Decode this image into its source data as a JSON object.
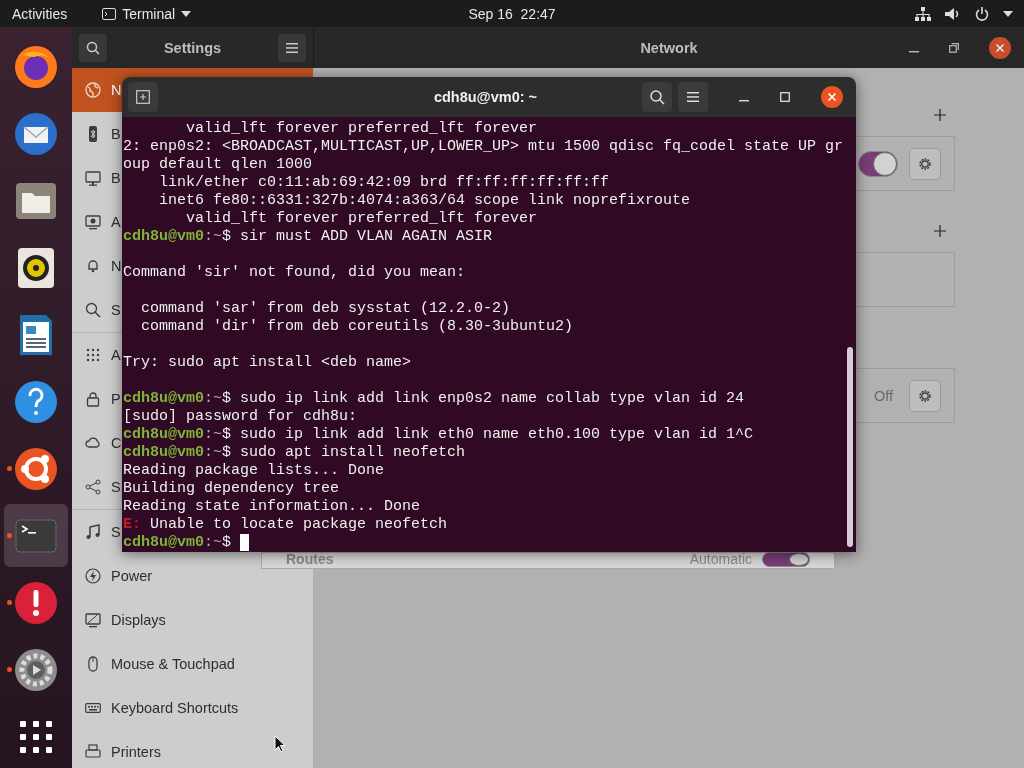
{
  "top_bar": {
    "activities": "Activities",
    "app_menu": "Terminal",
    "clock": "Sep 16  22:47"
  },
  "dock": [
    {
      "kind": "browser",
      "running": false,
      "selected": false
    },
    {
      "kind": "mail",
      "running": false,
      "selected": false
    },
    {
      "kind": "folder",
      "running": false,
      "selected": false
    },
    {
      "kind": "speaker",
      "running": false,
      "selected": false
    },
    {
      "kind": "document",
      "running": false,
      "selected": false
    },
    {
      "kind": "help",
      "running": false,
      "selected": false
    },
    {
      "kind": "software",
      "running": true,
      "selected": false
    },
    {
      "kind": "terminal",
      "running": true,
      "selected": true
    },
    {
      "kind": "alert",
      "running": true,
      "selected": false
    },
    {
      "kind": "settings",
      "running": true,
      "selected": false
    },
    {
      "kind": "grid",
      "running": false,
      "selected": false
    }
  ],
  "settings": {
    "title": "Settings",
    "panel_title": "Network",
    "sidebar": [
      {
        "items": [
          {
            "kind": "network",
            "label": "N",
            "selected": true
          },
          {
            "kind": "bluetooth",
            "label": "B",
            "selected": false
          },
          {
            "kind": "background",
            "label": "B",
            "selected": false
          },
          {
            "kind": "appearance",
            "label": "A",
            "selected": false
          },
          {
            "kind": "notifications",
            "label": "N",
            "selected": false
          },
          {
            "kind": "search",
            "label": "S",
            "selected": false
          }
        ]
      },
      {
        "items": [
          {
            "kind": "applications",
            "label": "A",
            "selected": false
          },
          {
            "kind": "privacy",
            "label": "P",
            "selected": false
          },
          {
            "kind": "online",
            "label": "C",
            "selected": false
          },
          {
            "kind": "sharing",
            "label": "S",
            "selected": false
          }
        ]
      },
      {
        "items": [
          {
            "kind": "sound",
            "label": "S",
            "selected": false
          },
          {
            "kind": "power",
            "label": "Power",
            "selected": false
          },
          {
            "kind": "displays",
            "label": "Displays",
            "selected": false
          },
          {
            "kind": "mouse",
            "label": "Mouse & Touchpad",
            "selected": false
          },
          {
            "kind": "keyboard",
            "label": "Keyboard Shortcuts",
            "selected": false
          },
          {
            "kind": "printers",
            "label": "Printers",
            "selected": false
          }
        ]
      }
    ],
    "sections": [
      {
        "add": true,
        "card": {
          "kind": "switch",
          "on": true
        }
      },
      {
        "add": true,
        "card": {
          "kind": "empty"
        }
      },
      {
        "add": false,
        "card": {
          "kind": "status",
          "status": "Off"
        }
      }
    ],
    "routes": {
      "label": "Routes",
      "mode": "Automatic",
      "on": true
    }
  },
  "terminal": {
    "title": "cdh8u@vm0: ~",
    "lines": [
      {
        "kind": "output",
        "text": "       valid_lft forever preferred_lft forever"
      },
      {
        "kind": "output",
        "text": "2: enp0s2: <BROADCAST,MULTICAST,UP,LOWER_UP> mtu 1500 qdisc fq_codel state UP gr"
      },
      {
        "kind": "output",
        "text": "oup default qlen 1000"
      },
      {
        "kind": "output",
        "text": "    link/ether c0:11:ab:69:42:09 brd ff:ff:ff:ff:ff:ff"
      },
      {
        "kind": "output",
        "text": "    inet6 fe80::6331:327b:4074:a363/64 scope link noprefixroute"
      },
      {
        "kind": "output",
        "text": "       valid_lft forever preferred_lft forever"
      },
      {
        "kind": "prompt",
        "user": "cdh8u@vm0",
        "path": ":~",
        "command": "$ sir must ADD VLAN AGAIN ASIR"
      },
      {
        "kind": "blank"
      },
      {
        "kind": "output",
        "text": "Command 'sir' not found, did you mean:"
      },
      {
        "kind": "blank"
      },
      {
        "kind": "output",
        "text": "  command 'sar' from deb sysstat (12.2.0-2)"
      },
      {
        "kind": "output",
        "text": "  command 'dir' from deb coreutils (8.30-3ubuntu2)"
      },
      {
        "kind": "blank"
      },
      {
        "kind": "output",
        "text": "Try: sudo apt install <deb name>"
      },
      {
        "kind": "blank"
      },
      {
        "kind": "prompt",
        "user": "cdh8u@vm0",
        "path": ":~",
        "command": "$ sudo ip link add link enp0s2 name collab type vlan id 24"
      },
      {
        "kind": "output",
        "text": "[sudo] password for cdh8u:"
      },
      {
        "kind": "prompt",
        "user": "cdh8u@vm0",
        "path": ":~",
        "command": "$ sudo ip link add link eth0 name eth0.100 type vlan id 1^C"
      },
      {
        "kind": "prompt",
        "user": "cdh8u@vm0",
        "path": ":~",
        "command": "$ sudo apt install neofetch"
      },
      {
        "kind": "output",
        "text": "Reading package lists... Done"
      },
      {
        "kind": "output",
        "text": "Building dependency tree"
      },
      {
        "kind": "output",
        "text": "Reading state information... Done"
      },
      {
        "kind": "error",
        "label": "E:",
        "text": " Unable to locate package neofetch"
      },
      {
        "kind": "prompt",
        "user": "cdh8u@vm0",
        "path": ":~",
        "command": "$",
        "cursor": true
      }
    ]
  }
}
